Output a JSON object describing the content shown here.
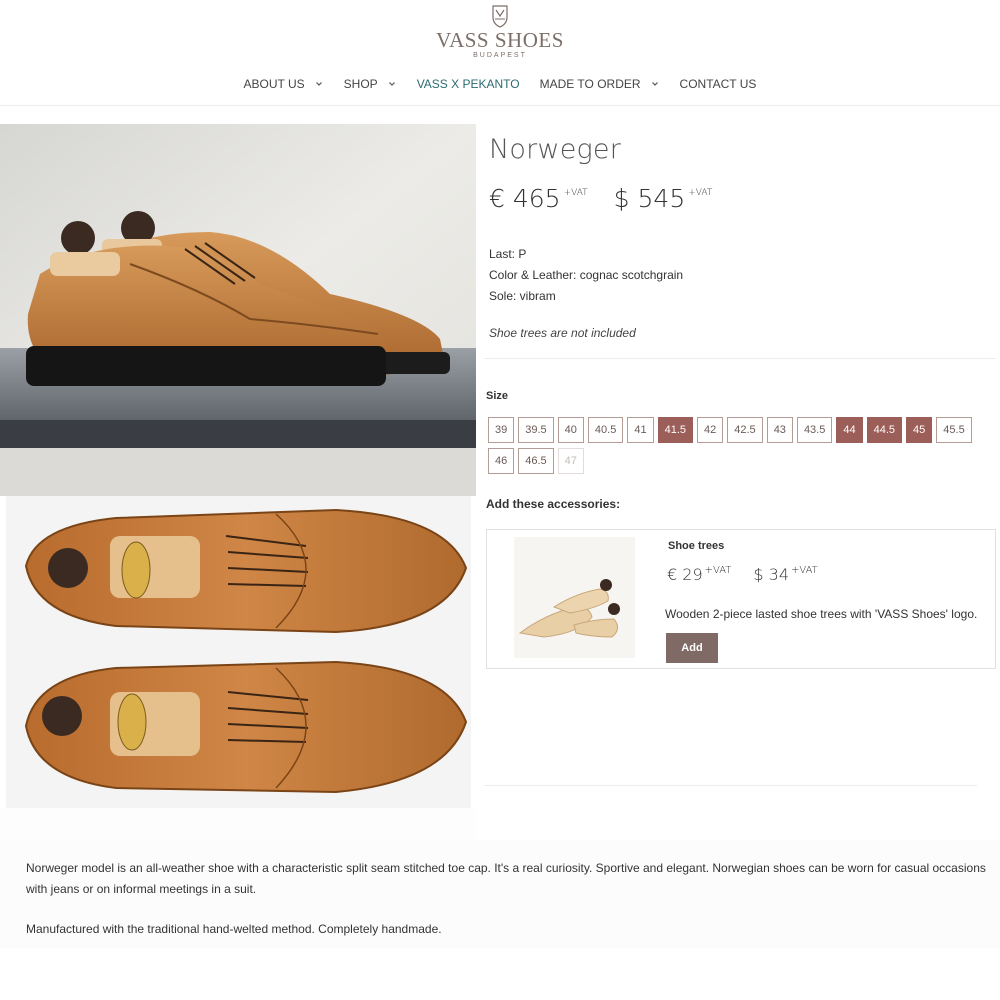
{
  "header": {
    "brand": "VASS SHOES",
    "brand_sub": "BUDAPEST",
    "nav": [
      {
        "label": "ABOUT US",
        "dropdown": true
      },
      {
        "label": "SHOP",
        "dropdown": true
      },
      {
        "label": "VASS X PEKANTO",
        "dropdown": false
      },
      {
        "label": "MADE TO ORDER",
        "dropdown": true
      },
      {
        "label": "CONTACT US",
        "dropdown": false
      }
    ]
  },
  "product": {
    "title": "Norweger",
    "price_eur": "€ 465",
    "price_usd": "$ 545",
    "vat": "+VAT",
    "last": "Last: P",
    "color": "Color & Leather: cognac scotchgrain",
    "sole": "Sole: vibram",
    "note": "Shoe trees are not included"
  },
  "sizes": {
    "label": "Size",
    "options": [
      {
        "v": "39",
        "s": "available"
      },
      {
        "v": "39.5",
        "s": "available"
      },
      {
        "v": "40",
        "s": "available"
      },
      {
        "v": "40.5",
        "s": "available"
      },
      {
        "v": "41",
        "s": "available"
      },
      {
        "v": "41.5",
        "s": "selected"
      },
      {
        "v": "42",
        "s": "available"
      },
      {
        "v": "42.5",
        "s": "available"
      },
      {
        "v": "43",
        "s": "available"
      },
      {
        "v": "43.5",
        "s": "available"
      },
      {
        "v": "44",
        "s": "selected"
      },
      {
        "v": "44.5",
        "s": "selected"
      },
      {
        "v": "45",
        "s": "selected"
      },
      {
        "v": "45.5",
        "s": "available"
      },
      {
        "v": "46",
        "s": "available"
      },
      {
        "v": "46.5",
        "s": "available"
      },
      {
        "v": "47",
        "s": "disabled"
      }
    ]
  },
  "accessories": {
    "label": "Add these accessories:",
    "item": {
      "name": "Shoe trees",
      "price_eur": "€ 29",
      "price_usd": "$ 34",
      "vat": "+VAT",
      "description": "Wooden 2-piece lasted shoe trees with 'VASS Shoes' logo.",
      "add_label": "Add"
    }
  },
  "description": {
    "p1": "Norweger model is an all-weather shoe with a characteristic split seam stitched toe cap. It's a real curiosity. Sportive and elegant. Norwegian shoes can be worn for casual occasions with jeans or on informal meetings in a suit.",
    "p2": "Manufactured with the traditional hand-welted method. Completely handmade."
  },
  "colors": {
    "accent": "#9b5e58",
    "button": "#7f6a66",
    "nav_active": "#2c6b72",
    "leather": "#b8743a"
  }
}
